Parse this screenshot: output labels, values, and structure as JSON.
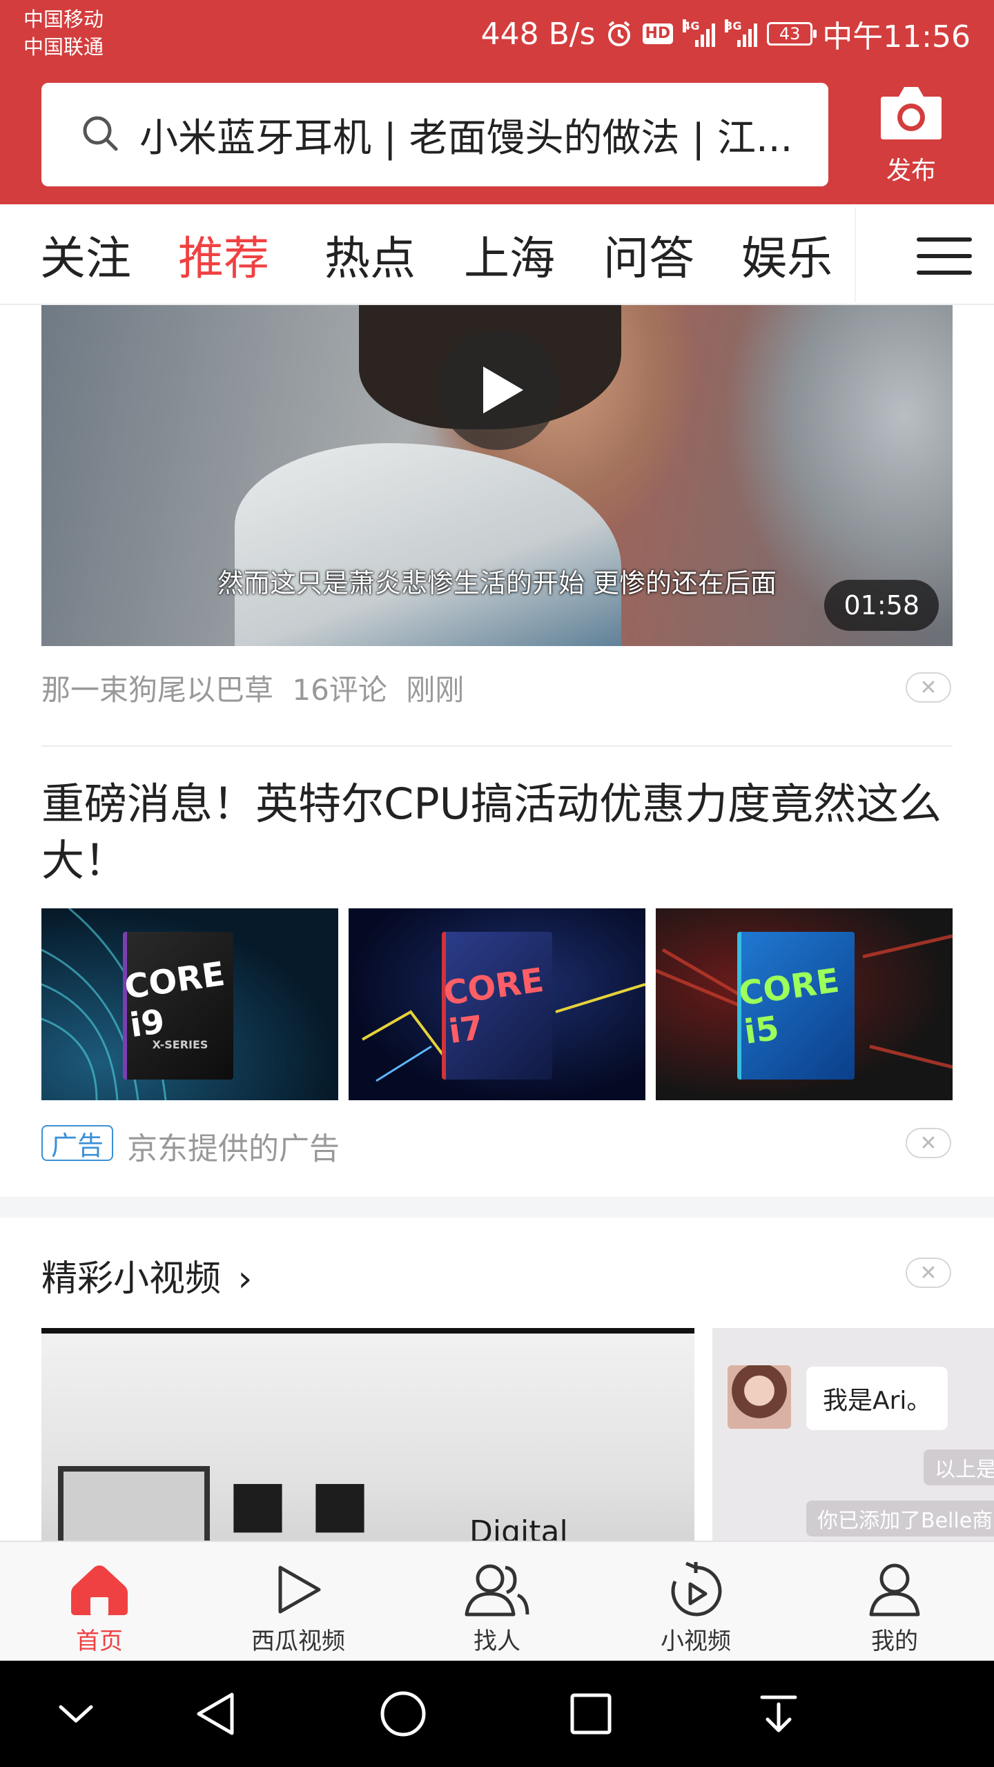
{
  "status_bar": {
    "carrier_1": "中国移动",
    "carrier_2": "中国联通",
    "net_speed": "448 B/s",
    "hd_badge": "HD",
    "net_type_1": "4G",
    "net_type_2": "3G",
    "battery": "43",
    "time": "中午11:56"
  },
  "header": {
    "search_text": "小米蓝牙耳机 | 老面馒头的做法 | 江...",
    "publish_label": "发布",
    "accent_color": "#d43d3d"
  },
  "tabs": {
    "items": [
      {
        "label": "关注"
      },
      {
        "label": "推荐"
      },
      {
        "label": "热点"
      },
      {
        "label": "上海"
      },
      {
        "label": "问答"
      },
      {
        "label": "娱乐"
      }
    ],
    "active_index": 1,
    "active_color": "#f04142"
  },
  "video_post": {
    "subtitle": "然而这只是萧炎悲惨生活的开始 更惨的还在后面",
    "duration": "01:58",
    "author": "那一束狗尾以巴草",
    "comments": "16评论",
    "time": "刚刚",
    "dismiss": "✕"
  },
  "ad_post": {
    "title": "重磅消息！英特尔CPU搞活动优惠力度竟然这么大！",
    "images": [
      {
        "label": "CORE i9",
        "sub": "X-SERIES"
      },
      {
        "label": "CORE i7",
        "sub": ""
      },
      {
        "label": "CORE i5",
        "sub": ""
      }
    ],
    "badge": "广告",
    "source": "京东提供的广告",
    "dismiss": "✕"
  },
  "small_video": {
    "title": "精彩小视频",
    "arrow": "›",
    "dismiss": "✕",
    "card_1_text": "Digital",
    "card_2_bubble": "我是Ari。",
    "card_2_sys_1": "以上是",
    "card_2_sys_2": "你已添加了Belle商"
  },
  "bottom_nav": {
    "items": [
      {
        "label": "首页",
        "icon": "home-icon"
      },
      {
        "label": "西瓜视频",
        "icon": "play-outline-icon"
      },
      {
        "label": "找人",
        "icon": "people-icon"
      },
      {
        "label": "小视频",
        "icon": "small-video-icon"
      },
      {
        "label": "我的",
        "icon": "person-icon"
      }
    ],
    "active_index": 0
  }
}
